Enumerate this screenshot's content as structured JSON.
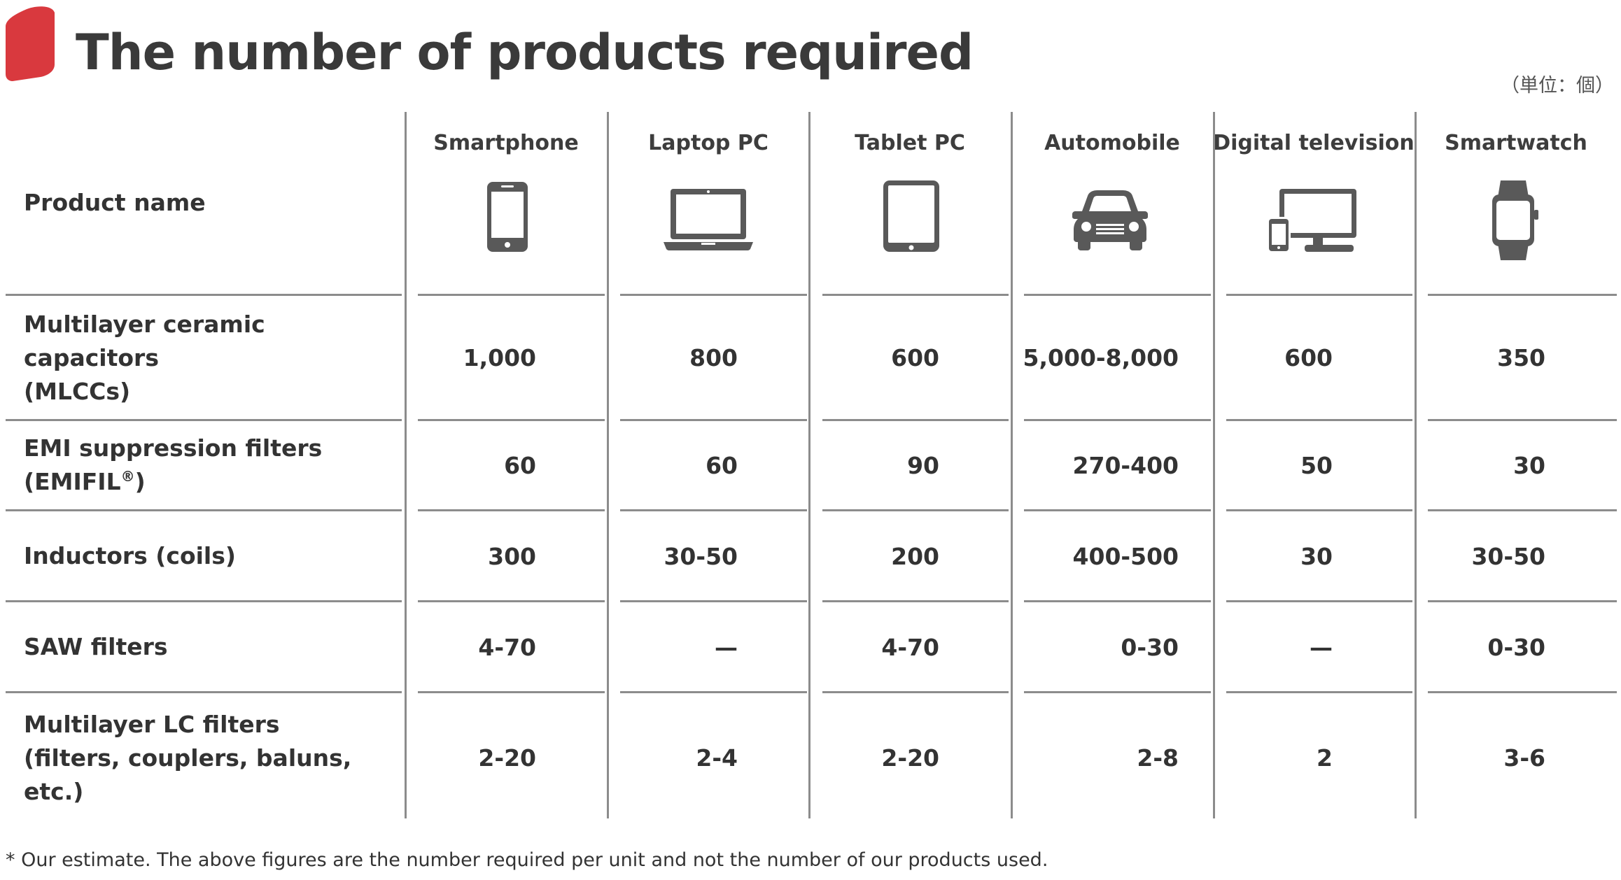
{
  "title": "The number of products required",
  "unit_note": "（単位：個）",
  "colors": {
    "accent": "#d9393e",
    "icon": "#595959",
    "line": "#8c8c8c",
    "text": "#333333"
  },
  "header": {
    "row_label": "Product name",
    "columns": [
      {
        "label": "Smartphone",
        "icon": "smartphone-icon"
      },
      {
        "label": "Laptop PC",
        "icon": "laptop-icon"
      },
      {
        "label": "Tablet PC",
        "icon": "tablet-icon"
      },
      {
        "label": "Automobile",
        "icon": "car-icon"
      },
      {
        "label": "Digital television",
        "icon": "television-icon"
      },
      {
        "label": "Smartwatch",
        "icon": "smartwatch-icon"
      }
    ]
  },
  "rows": [
    {
      "label_lines": [
        "Multilayer ceramic capacitors",
        "(MLCCs)"
      ],
      "values": [
        "1,000",
        "800",
        "600",
        "5,000-8,000",
        "600",
        "350"
      ]
    },
    {
      "label": "EMI suppression filters (EMIFIL",
      "label_sup": "®",
      "label_end": ")",
      "values": [
        "60",
        "60",
        "90",
        "270-400",
        "50",
        "30"
      ]
    },
    {
      "label": "Inductors (coils)",
      "values": [
        "300",
        "30-50",
        "200",
        "400-500",
        "30",
        "30-50"
      ]
    },
    {
      "label": "SAW filters",
      "values": [
        "4-70",
        "—",
        "4-70",
        "0-30",
        "—",
        "0-30"
      ]
    },
    {
      "label_lines": [
        "Multilayer LC filters",
        "(filters, couplers, baluns, etc.)"
      ],
      "values": [
        "2-20",
        "2-4",
        "2-20",
        "2-8",
        "2",
        "3-6"
      ]
    }
  ],
  "footnote": "* Our estimate. The above figures are the number required per unit and not the number of our products used."
}
